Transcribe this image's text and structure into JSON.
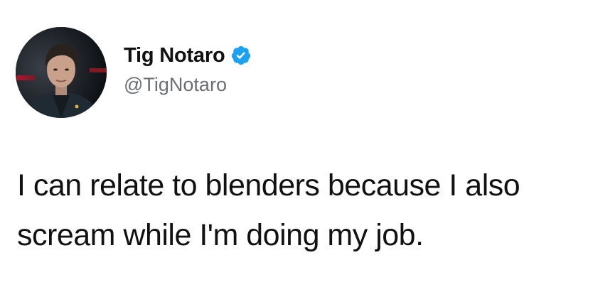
{
  "tweet": {
    "author": {
      "display_name": "Tig Notaro",
      "handle": "@TigNotaro",
      "verified": true,
      "avatar_icon": "profile-photo"
    },
    "text": "I can relate to blenders because I also scream while I'm doing my job."
  },
  "colors": {
    "background": "#ffffff",
    "text": "#111111",
    "handle": "#6b6f74",
    "verified_badge": "#1da1f2"
  }
}
